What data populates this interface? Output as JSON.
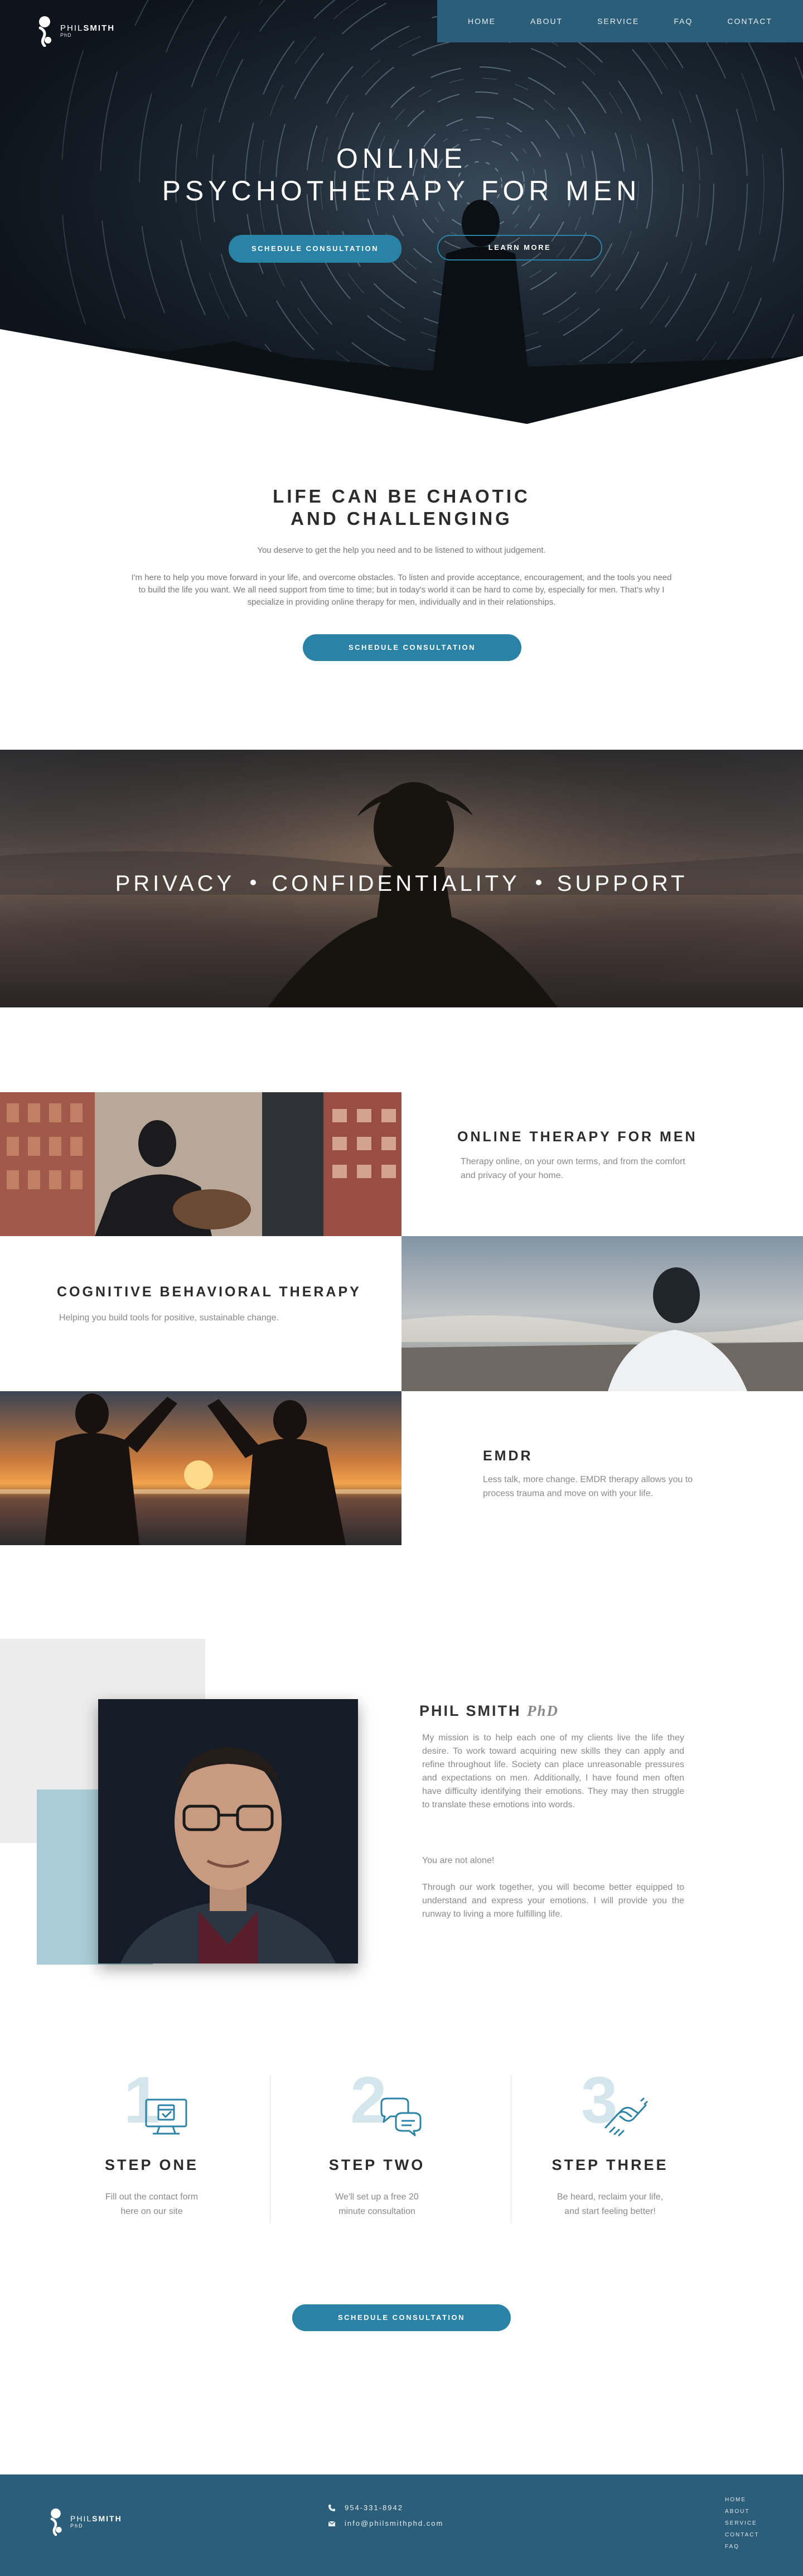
{
  "brand": {
    "name_first": "PHIL",
    "name_last": "SMITH",
    "suffix": "PhD"
  },
  "nav": [
    "HOME",
    "ABOUT",
    "SERVICE",
    "FAQ",
    "CONTACT"
  ],
  "hero": {
    "title_line1": "ONLINE",
    "title_line2": "PSYCHOTHERAPY FOR MEN",
    "primary_cta": "SCHEDULE CONSULTATION",
    "secondary_cta": "LEARN MORE"
  },
  "intro": {
    "title_line1": "LIFE CAN BE CHAOTIC",
    "title_line2": "AND CHALLENGING",
    "lead": "You deserve to get the help you need and to be listened to without judgement.",
    "body": "I'm here to help you move forward in your life, and overcome obstacles. To listen and provide acceptance, encouragement, and the tools you need to build the life you want. We all need support from time to time; but in today's world it can be hard to come by, especially for men. That's why I specialize in providing online therapy for men, individually and in their relationships.",
    "cta": "SCHEDULE CONSULTATION"
  },
  "banner": {
    "words": [
      "PRIVACY",
      "CONFIDENTIALITY",
      "SUPPORT"
    ]
  },
  "services": [
    {
      "title": "ONLINE THERAPY FOR MEN",
      "text": "Therapy online, on your own terms, and from the comfort and privacy of your home."
    },
    {
      "title": "COGNITIVE BEHAVIORAL THERAPY",
      "text": "Helping you build tools for positive, sustainable change."
    },
    {
      "title": "EMDR",
      "text": "Less talk, more change. EMDR therapy allows you to process  trauma and move on with your life."
    }
  ],
  "about": {
    "name": "PHIL SMITH",
    "suffix": "PhD",
    "p1": "My mission is to help each one of my clients live the life they desire.  To work toward acquiring new skills they can apply and refine throughout life. Society can place unreasonable pressures and expectations on men. Additionally, I have found men often have difficulty identifying their emotions. They may then struggle to translate these emotions into words.",
    "p2": "You are not alone!",
    "p3": "Through our work together, you will become better equipped to understand and express your emotions. I will provide you the runway to living a more fulfilling life."
  },
  "steps": [
    {
      "num": "1",
      "icon": "computer-calendar-icon",
      "title": "STEP ONE",
      "line1": "Fill out the contact form",
      "line2": "here on our site"
    },
    {
      "num": "2",
      "icon": "chat-bubbles-icon",
      "title": "STEP TWO",
      "line1": "We'll set up a free 20",
      "line2": "minute consultation"
    },
    {
      "num": "3",
      "icon": "handshake-icon",
      "title": "STEP THREE",
      "line1": "Be heard, reclaim your life,",
      "line2": "and start feeling better!"
    }
  ],
  "steps_cta": "SCHEDULE CONSULTATION",
  "footer": {
    "phone": "954-331-8942",
    "email": "info@philsmithphd.com",
    "nav": [
      "HOME",
      "ABOUT",
      "SERVICE",
      "CONTACT",
      "FAQ"
    ]
  },
  "colors": {
    "brand_blue": "#2c5d79",
    "accent": "#2a83a6",
    "light_blue": "#a9ccd8"
  }
}
